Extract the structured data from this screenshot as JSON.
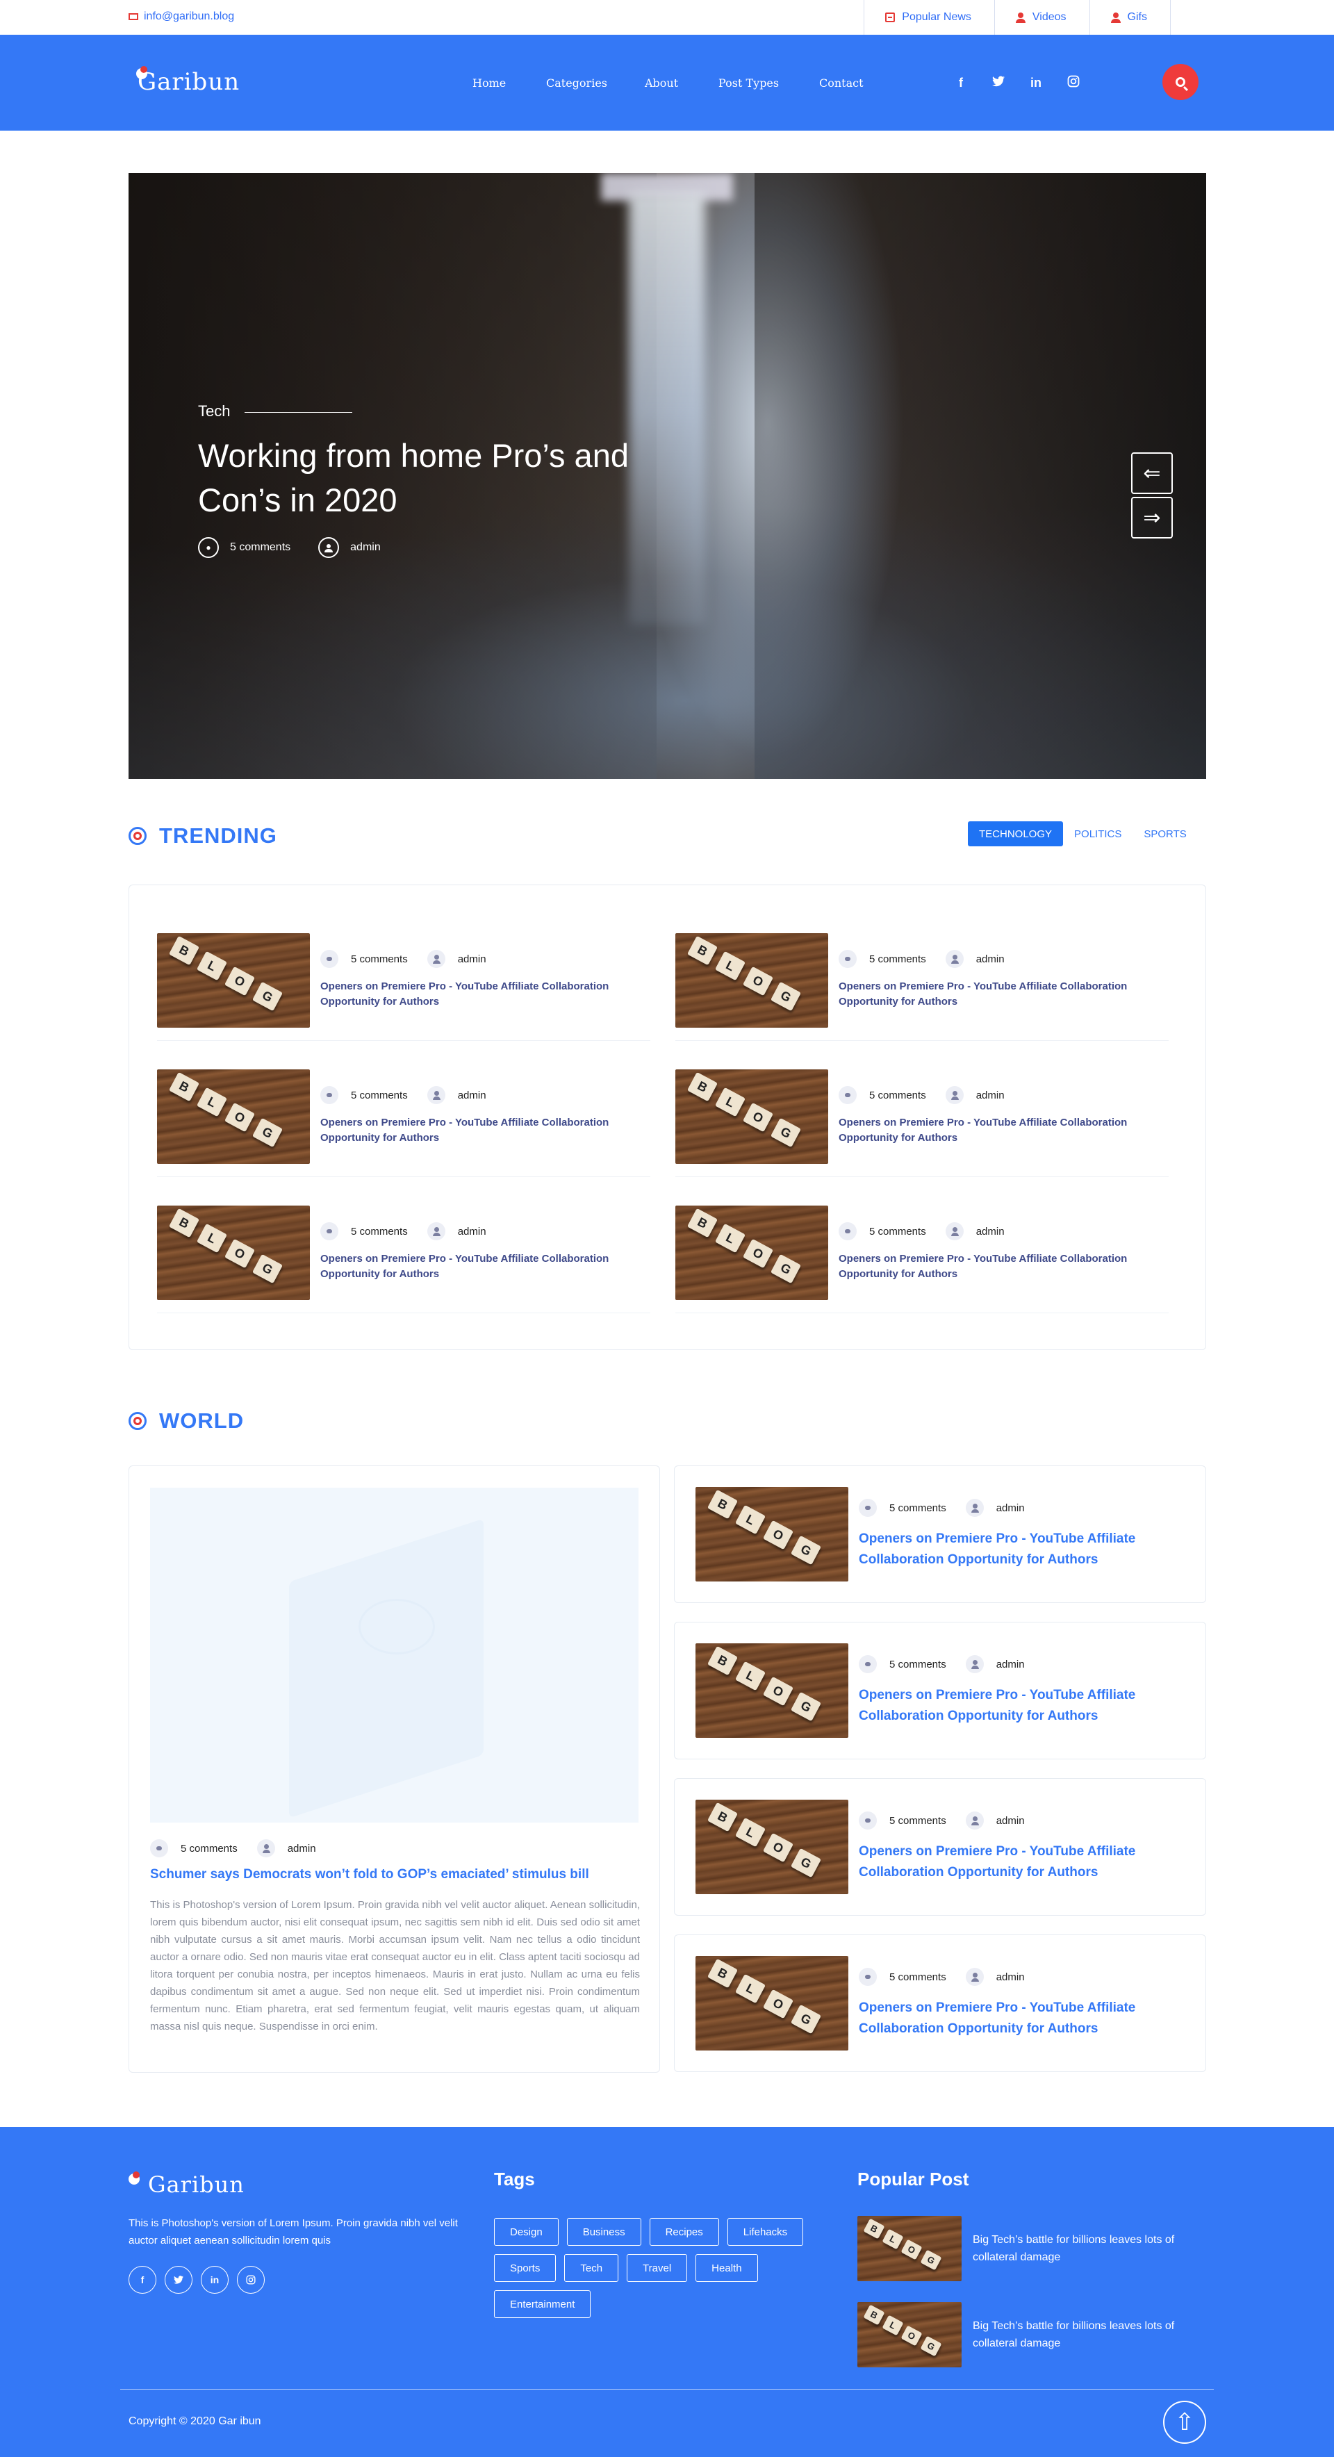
{
  "topbar": {
    "email": "info@garibun.blog",
    "links": [
      {
        "label": "Popular News",
        "icon": "news-icon"
      },
      {
        "label": "Videos",
        "icon": "user-icon"
      },
      {
        "label": "Gifs",
        "icon": "user-icon"
      }
    ]
  },
  "header": {
    "logo": "Garibun",
    "nav": [
      "Home",
      "Categories",
      "About",
      "Post Types",
      "Contact"
    ],
    "social": [
      "f",
      "t",
      "in",
      "ig"
    ],
    "search_icon": "search-icon"
  },
  "hero": {
    "category": "Tech",
    "title": "Working from home Pro’s and Con’s in 2020",
    "comments": "5 comments",
    "author": "admin",
    "prev_arrow": "⇐",
    "next_arrow": "⇒"
  },
  "trending": {
    "title": "TRENDING",
    "tabs": [
      "TECHNOLOGY",
      "POLITICS",
      "SPORTS"
    ],
    "active_tab": "TECHNOLOGY",
    "posts": [
      {
        "comments": "5 comments",
        "author": "admin",
        "title": "Openers on Premiere Pro - YouTube Affiliate Collaboration Opportunity for Authors"
      },
      {
        "comments": "5 comments",
        "author": "admin",
        "title": "Openers on Premiere Pro - YouTube Affiliate Collaboration Opportunity for Authors"
      },
      {
        "comments": "5 comments",
        "author": "admin",
        "title": "Openers on Premiere Pro - YouTube Affiliate Collaboration Opportunity for Authors"
      },
      {
        "comments": "5 comments",
        "author": "admin",
        "title": "Openers on Premiere Pro - YouTube Affiliate Collaboration Opportunity for Authors"
      },
      {
        "comments": "5 comments",
        "author": "admin",
        "title": "Openers on Premiere Pro - YouTube Affiliate Collaboration Opportunity for Authors"
      },
      {
        "comments": "5 comments",
        "author": "admin",
        "title": "Openers on Premiere Pro - YouTube Affiliate Collaboration Opportunity for Authors"
      }
    ],
    "thumb_text": "BLOG"
  },
  "world": {
    "title": "WORLD",
    "main": {
      "comments": "5 comments",
      "author": "admin",
      "title": "Schumer says Democrats won’t fold to GOP’s emaciated’ stimulus bill",
      "body": "This is Photoshop's version of Lorem Ipsum. Proin gravida nibh vel velit auctor aliquet. Aenean sollicitudin, lorem quis bibendum auctor, nisi elit consequat ipsum, nec sagittis sem nibh id elit. Duis sed odio sit amet nibh vulputate cursus a sit amet mauris. Morbi accumsan ipsum velit. Nam nec tellus a odio tincidunt auctor a ornare odio. Sed non mauris vitae erat consequat auctor eu in elit. Class aptent taciti sociosqu ad litora torquent per conubia nostra, per inceptos himenaeos. Mauris in erat justo. Nullam ac urna eu felis dapibus condimentum sit amet a augue. Sed non neque elit. Sed ut imperdiet nisi. Proin condimentum fermentum nunc. Etiam pharetra, erat sed fermentum feugiat, velit mauris egestas quam, ut aliquam massa nisl quis neque. Suspendisse in orci enim."
    },
    "side": [
      {
        "comments": "5 comments",
        "author": "admin",
        "title": "Openers on Premiere Pro - YouTube Affiliate Collaboration Opportunity for Authors"
      },
      {
        "comments": "5 comments",
        "author": "admin",
        "title": "Openers on Premiere Pro - YouTube Affiliate Collaboration Opportunity for Authors"
      },
      {
        "comments": "5 comments",
        "author": "admin",
        "title": "Openers on Premiere Pro - YouTube Affiliate Collaboration Opportunity for Authors"
      },
      {
        "comments": "5 comments",
        "author": "admin",
        "title": "Openers on Premiere Pro - YouTube Affiliate Collaboration Opportunity for Authors"
      }
    ]
  },
  "footer": {
    "logo": "Garibun",
    "description": "This is Photoshop's version of Lorem Ipsum. Proin gravida nibh vel velit auctor aliquet aenean sollicitudin lorem quis",
    "social": [
      "f",
      "t",
      "in",
      "ig"
    ],
    "tags_title": "Tags",
    "tags": [
      "Design",
      "Business",
      "Recipes",
      "Lifehacks",
      "Sports",
      "Tech",
      "Travel",
      "Health",
      "Entertainment"
    ],
    "popular_title": "Popular Post",
    "popular": [
      {
        "title": "Big Tech’s battle for billions leaves lots of collateral damage"
      },
      {
        "title": "Big Tech’s battle for billions leaves lots of collateral damage"
      }
    ],
    "copyright": "Copyright © 2020 Gar ibun",
    "up_arrow": "⇧"
  },
  "colors": {
    "primary": "#3478f6",
    "accent_red": "#e53935",
    "title_navy": "#3f4a8a"
  }
}
